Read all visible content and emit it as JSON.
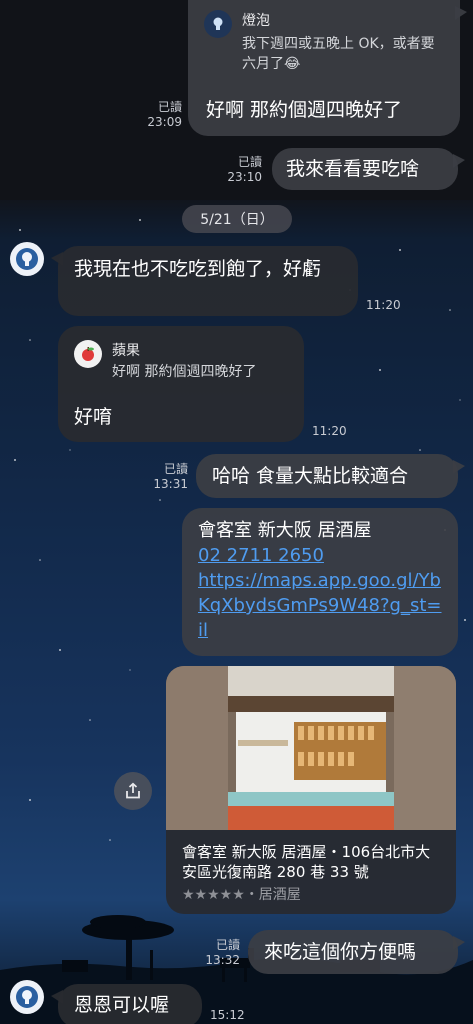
{
  "messages": {
    "m1": {
      "quote_name": "燈泡",
      "quote_text": "我下週四或五晚上 OK，或者要六月了😂",
      "text": "好啊 那約個週四晚好了",
      "read": "已讀",
      "time": "23:09"
    },
    "m2": {
      "text": "我來看看要吃啥",
      "read": "已讀",
      "time": "23:10"
    },
    "date": "5/21（日）",
    "m3": {
      "text": "我現在也不吃吃到飽了，好虧",
      "time": "11:20"
    },
    "m4": {
      "quote_name": "蘋果",
      "quote_text": "好啊 那約個週四晚好了",
      "text": "好唷",
      "time": "11:20"
    },
    "m5": {
      "text": "哈哈 食量大點比較適合",
      "read": "已讀",
      "time": "13:31"
    },
    "m6": {
      "title": "會客室 新大阪 居酒屋",
      "phone": "02 2711 2650",
      "url": "https://maps.app.goo.gl/YbKqXbydsGmPs9W48?g_st=il"
    },
    "m7": {
      "place": "會客室 新大阪 居酒屋・106台北市大安區光復南路 280 巷 33 號",
      "stars": "★★★★★",
      "category": "・居酒屋",
      "rating": 0
    },
    "m8": {
      "text": "來吃這個你方便嗎",
      "read": "已讀",
      "time": "13:32"
    },
    "m9": {
      "text": "恩恩可以喔",
      "time": "15:12"
    }
  },
  "icons": {
    "avatar": "lightbulb-icon",
    "quote_avatar_1": "lightbulb-icon",
    "quote_avatar_2": "apple-icon",
    "share": "share-icon"
  }
}
